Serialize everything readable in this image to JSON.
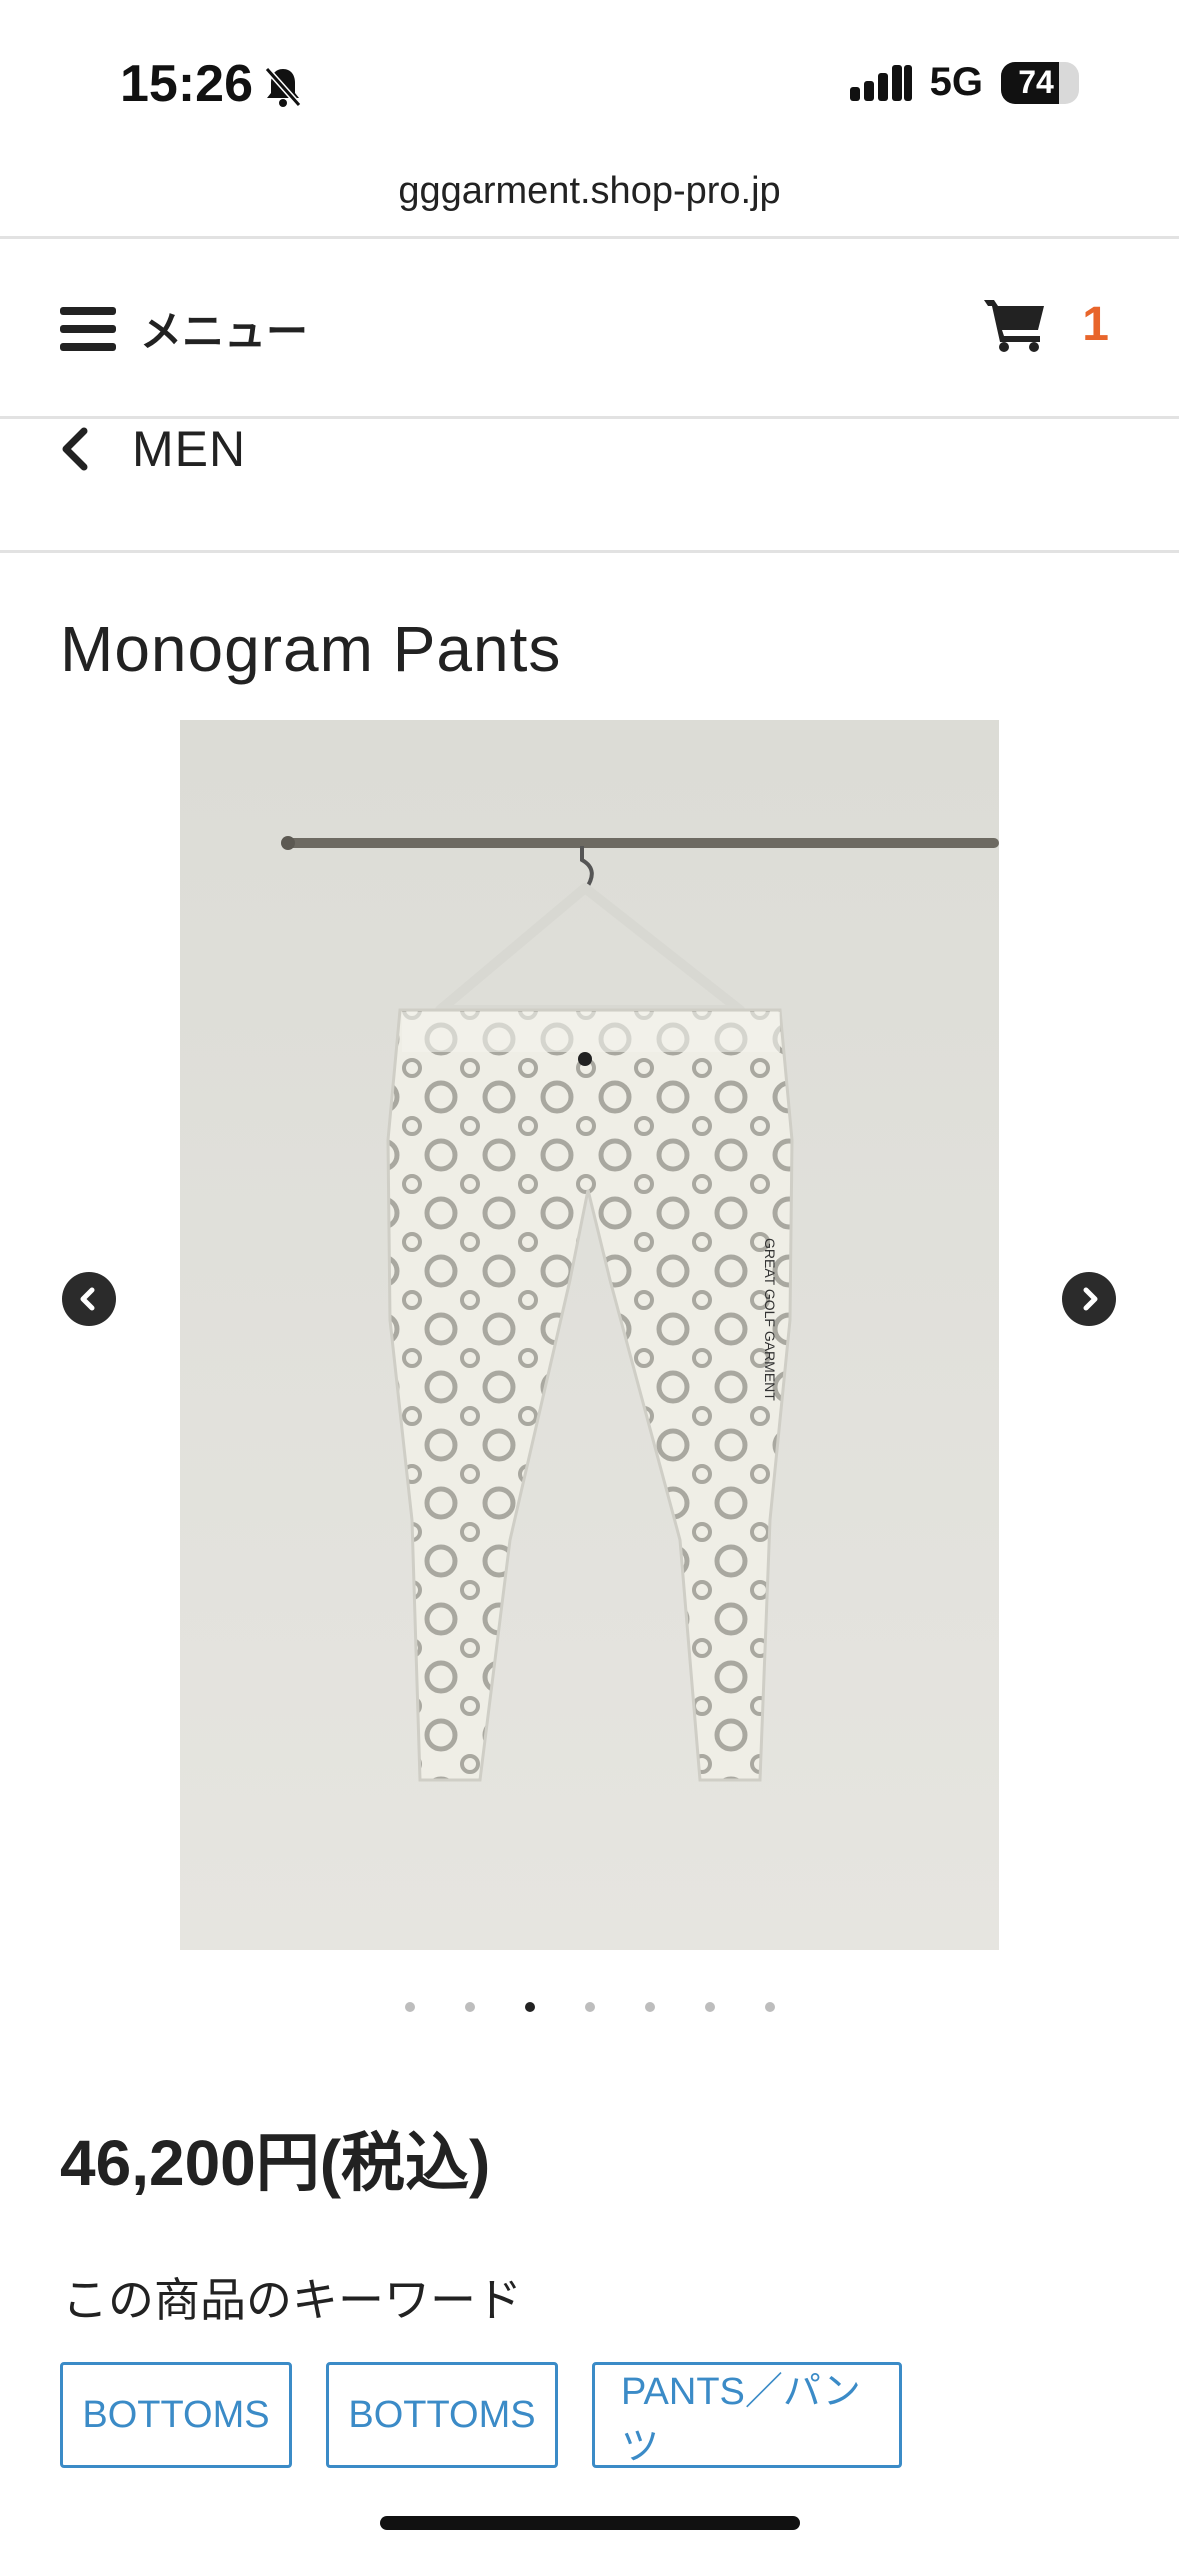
{
  "status_bar": {
    "time": "15:26",
    "network": "5G",
    "battery": "74",
    "battery_level": 0.74
  },
  "browser": {
    "url": "gggarment.shop-pro.jp"
  },
  "header": {
    "menu_label": "メニュー",
    "cart_count": "1",
    "accent_color": "#e8652b"
  },
  "breadcrumb": {
    "label": "MEN"
  },
  "product": {
    "title": "Monogram Pants",
    "image_text": "GREAT GOLF GARMENT",
    "price": "46,200円(税込)",
    "carousel": {
      "total": 7,
      "active_index": 3
    },
    "keyword_heading": "この商品のキーワード",
    "tags": [
      "BOTTOMS",
      "BOTTOMS",
      "PANTS／パンツ"
    ],
    "tag_color": "#3b8bc7"
  },
  "icons": {
    "status": [
      "bell-off-icon",
      "signal-icon",
      "battery-icon"
    ],
    "header": [
      "hamburger-icon",
      "cart-icon"
    ],
    "nav": [
      "chevron-left-icon",
      "arrow-left-circle-icon",
      "arrow-right-circle-icon"
    ]
  }
}
